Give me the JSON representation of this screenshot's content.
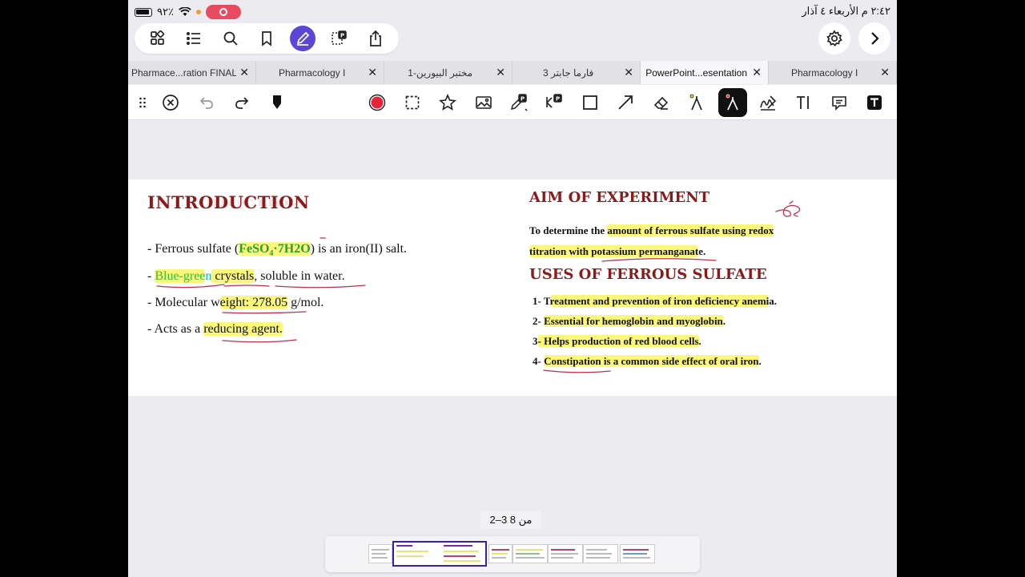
{
  "status_bar": {
    "battery": "٩٢٪",
    "clock": "٢:٤٢ م  الأربعاء ٤ آذار"
  },
  "tabs": [
    {
      "label": "Pharmace...ration FINAL",
      "active": false
    },
    {
      "label": "Pharmacology I",
      "active": false
    },
    {
      "label": "مختبر البيورين-1",
      "active": false
    },
    {
      "label": "فارما جابتر 3",
      "active": false
    },
    {
      "label": "PowerPoint...esentation",
      "active": true
    },
    {
      "label": "Pharmacology I",
      "active": false
    }
  ],
  "icons": {
    "top": [
      "grid-icon",
      "list-icon",
      "search-icon",
      "bookmark-icon",
      "pen-edit-icon",
      "pdf-convert-icon",
      "share-icon"
    ],
    "right": [
      "gear-icon",
      "chevron-right-icon"
    ],
    "tools": [
      "drag-handle-icon",
      "close-circle-icon",
      "undo-icon",
      "redo-icon",
      "pen-tip-icon",
      "record-icon",
      "lasso-select-icon",
      "star-icon",
      "image-icon",
      "pdf-annotate-icon",
      "pdf-link-icon",
      "rectangle-icon",
      "arrow-icon",
      "eraser-icon",
      "laser-pointer-icon",
      "pen-tool-icon",
      "signature-icon",
      "text-cursor-icon",
      "comment-icon",
      "text-box-icon"
    ]
  },
  "colors": {
    "accent": "#5b46d6",
    "heading": "#8b1a1a",
    "highlight": "#fbf77a",
    "pen_red": "#c0304a",
    "record": "#e84a5f"
  },
  "slide": {
    "intro_title": "INTRODUCTION",
    "intro_bullets": {
      "b1_pre": "- Ferrous sulfate (",
      "b1_formula": "FeSO",
      "b1_sub": "4",
      "b1_formula2": "·7H2O",
      "b1_post": ") is an iron(II) salt.",
      "b2_dash": "- ",
      "b2_blue": "Blue-gree",
      "b2_n": "n",
      "b2_mid": " crystals",
      "b2_post": ", soluble in water.",
      "b3_pre": "- Molecular w",
      "b3_hl": "eight: 278.05",
      "b3_post": " g/mol.",
      "b4_pre": "- Acts as a ",
      "b4_hl": "reducing agent."
    },
    "aim_title": "AIM OF EXPERIMENT",
    "aim_line1_pre": "To determine the ",
    "aim_line1_hl": "amount of ferrous sulfate using redox",
    "aim_line2_hl": "titration with potassium permanganat",
    "aim_line2_post": "e.",
    "uses_title": "USES OF FERROUS SULFATE",
    "uses": [
      {
        "num": "1- T",
        "text": "reatment and prevention of iron deficiency anemi",
        "tail": "a."
      },
      {
        "num": "2- ",
        "text": "Essential for hemoglobin and myoglobin",
        "tail": "."
      },
      {
        "num": "3",
        "text": "- Helps production of red blood cells",
        "tail": "."
      },
      {
        "num": "4- ",
        "text": "Constipation is a common side effect of oral iron",
        "tail": "."
      }
    ]
  },
  "page_indicator": "2–3 من 8"
}
